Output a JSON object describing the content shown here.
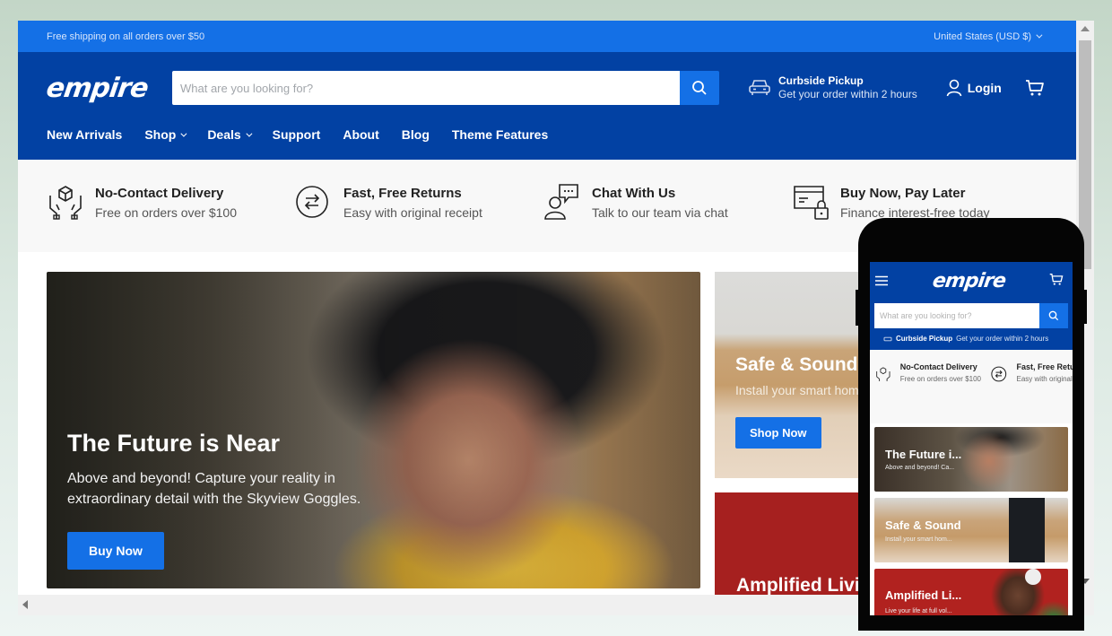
{
  "announcement": {
    "text": "Free shipping on all orders over $50",
    "country_selector": "United States (USD $)"
  },
  "header": {
    "logo": "empire",
    "search_placeholder": "What are you looking for?",
    "curbside": {
      "title": "Curbside Pickup",
      "subtitle": "Get your order within 2 hours"
    },
    "login_label": "Login",
    "nav": [
      {
        "label": "New Arrivals",
        "dropdown": false
      },
      {
        "label": "Shop",
        "dropdown": true
      },
      {
        "label": "Deals",
        "dropdown": true
      },
      {
        "label": "Support",
        "dropdown": false
      },
      {
        "label": "About",
        "dropdown": false
      },
      {
        "label": "Blog",
        "dropdown": false
      },
      {
        "label": "Theme Features",
        "dropdown": false
      }
    ]
  },
  "features": [
    {
      "icon": "hands-box-icon",
      "title": "No-Contact Delivery",
      "subtitle": "Free on orders over $100"
    },
    {
      "icon": "exchange-arrows-icon",
      "title": "Fast, Free Returns",
      "subtitle": "Easy with original receipt"
    },
    {
      "icon": "chat-person-icon",
      "title": "Chat With Us",
      "subtitle": "Talk to our team via chat"
    },
    {
      "icon": "card-lock-icon",
      "title": "Buy Now, Pay Later",
      "subtitle": "Finance interest-free today"
    }
  ],
  "hero": {
    "title": "The Future is Near",
    "text": "Above and beyond! Capture your reality in extraordinary detail with the Skyview Goggles.",
    "button": "Buy Now"
  },
  "promos": [
    {
      "title": "Safe & Sound",
      "text": "Install your smart home",
      "button": "Shop Now"
    },
    {
      "title": "Amplified Living"
    }
  ],
  "mobile": {
    "logo": "empire",
    "search_placeholder": "What are you looking for?",
    "curbside_title": "Curbside Pickup",
    "curbside_subtitle": "Get your order within 2 hours",
    "features": [
      {
        "title": "No-Contact Delivery",
        "subtitle": "Free on orders over $100"
      },
      {
        "title": "Fast, Free Returns",
        "subtitle": "Easy with original receipt"
      }
    ],
    "cards": [
      {
        "title": "The Future i...",
        "text": "Above and beyond! Ca..."
      },
      {
        "title": "Safe & Sound",
        "text": "Install your smart hom..."
      },
      {
        "title": "Amplified Li...",
        "text": "Live your life at full vol..."
      }
    ]
  },
  "colors": {
    "announcement_bg": "#1470e6",
    "header_bg": "#0241a3",
    "accent": "#1470e6",
    "promo_red": "#a6201f"
  }
}
